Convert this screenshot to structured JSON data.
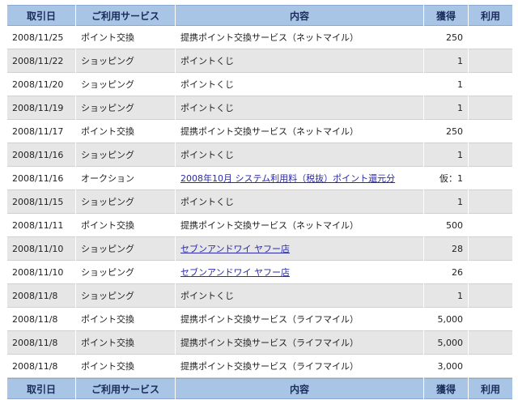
{
  "table": {
    "headers": [
      "取引日",
      "ご利用サービス",
      "内容",
      "獲得",
      "利用"
    ],
    "rows": [
      {
        "date": "2008/11/25",
        "service": "ポイント交換",
        "content": "提携ポイント交換サービス（ネットマイル）",
        "link": false,
        "earned": "250",
        "used": ""
      },
      {
        "date": "2008/11/22",
        "service": "ショッピング",
        "content": "ポイントくじ",
        "link": false,
        "earned": "1",
        "used": ""
      },
      {
        "date": "2008/11/20",
        "service": "ショッピング",
        "content": "ポイントくじ",
        "link": false,
        "earned": "1",
        "used": ""
      },
      {
        "date": "2008/11/19",
        "service": "ショッピング",
        "content": "ポイントくじ",
        "link": false,
        "earned": "1",
        "used": ""
      },
      {
        "date": "2008/11/17",
        "service": "ポイント交換",
        "content": "提携ポイント交換サービス（ネットマイル）",
        "link": false,
        "earned": "250",
        "used": ""
      },
      {
        "date": "2008/11/16",
        "service": "ショッピング",
        "content": "ポイントくじ",
        "link": false,
        "earned": "1",
        "used": ""
      },
      {
        "date": "2008/11/16",
        "service": "オークション",
        "content": "2008年10月 システム利用料（税抜）ポイント還元分",
        "link": true,
        "earned": "仮：1",
        "used": ""
      },
      {
        "date": "2008/11/15",
        "service": "ショッピング",
        "content": "ポイントくじ",
        "link": false,
        "earned": "1",
        "used": ""
      },
      {
        "date": "2008/11/11",
        "service": "ポイント交換",
        "content": "提携ポイント交換サービス（ネットマイル）",
        "link": false,
        "earned": "500",
        "used": ""
      },
      {
        "date": "2008/11/10",
        "service": "ショッピング",
        "content": "セブンアンドワイ ヤフー店",
        "link": true,
        "earned": "28",
        "used": ""
      },
      {
        "date": "2008/11/10",
        "service": "ショッピング",
        "content": "セブンアンドワイ ヤフー店",
        "link": true,
        "earned": "26",
        "used": ""
      },
      {
        "date": "2008/11/8",
        "service": "ショッピング",
        "content": "ポイントくじ",
        "link": false,
        "earned": "1",
        "used": ""
      },
      {
        "date": "2008/11/8",
        "service": "ポイント交換",
        "content": "提携ポイント交換サービス（ライフマイル）",
        "link": false,
        "earned": "5,000",
        "used": ""
      },
      {
        "date": "2008/11/8",
        "service": "ポイント交換",
        "content": "提携ポイント交換サービス（ライフマイル）",
        "link": false,
        "earned": "5,000",
        "used": ""
      },
      {
        "date": "2008/11/8",
        "service": "ポイント交換",
        "content": "提携ポイント交換サービス（ライフマイル）",
        "link": false,
        "earned": "3,000",
        "used": ""
      }
    ]
  }
}
